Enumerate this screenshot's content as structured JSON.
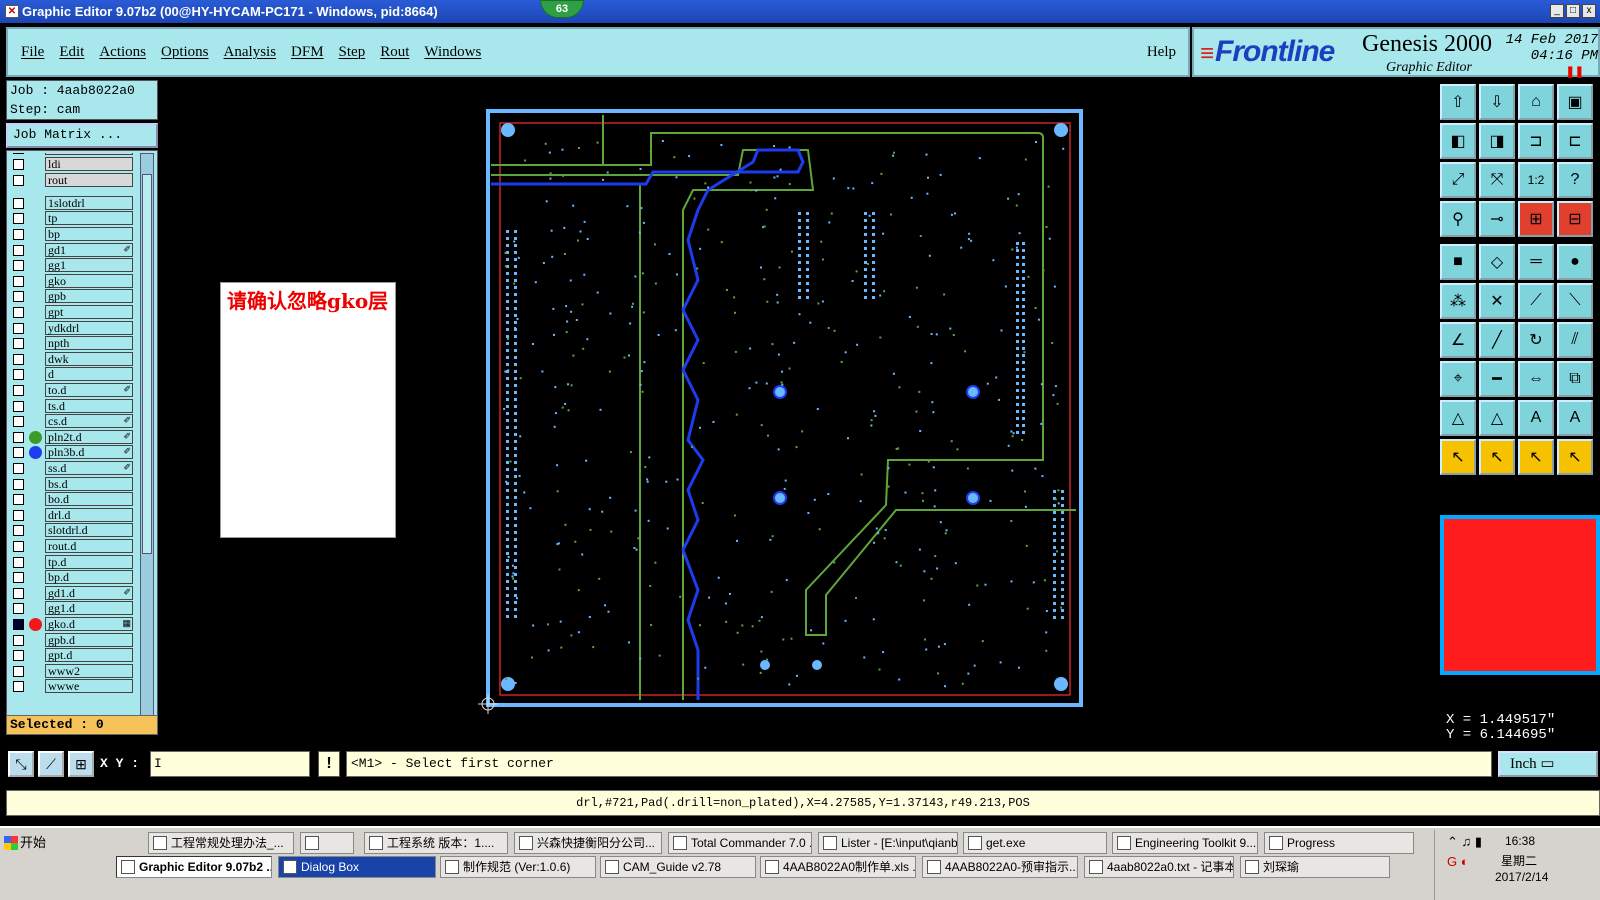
{
  "window": {
    "title": "Graphic Editor 9.07b2 (00@HY-HYCAM-PC171 - Windows, pid:8664)",
    "badge": "63",
    "controls": [
      "_",
      "□",
      "x"
    ]
  },
  "menu": {
    "items": [
      "File",
      "Edit",
      "Actions",
      "Options",
      "Analysis",
      "DFM",
      "Step",
      "Rout",
      "Windows"
    ],
    "help": "Help"
  },
  "brand": {
    "logo": "Frontline",
    "product": "Genesis 2000",
    "subtitle": "Graphic Editor",
    "date": "14 Feb 2017",
    "time": "04:16 PM"
  },
  "job": {
    "job_line": "Job : 4aab8022a0",
    "step_line": "Step: cam",
    "matrix_button": "Job Matrix ..."
  },
  "layers": [
    {
      "name": "drl",
      "gray": true
    },
    {
      "name": "ldi",
      "gray": true
    },
    {
      "name": "rout",
      "gray": true
    },
    {
      "name": "1slotdrl"
    },
    {
      "name": "tp"
    },
    {
      "name": "bp"
    },
    {
      "name": "gd1",
      "mark": "✐"
    },
    {
      "name": "gg1"
    },
    {
      "name": "gko"
    },
    {
      "name": "gpb"
    },
    {
      "name": "gpt"
    },
    {
      "name": "ydkdrl"
    },
    {
      "name": "npth"
    },
    {
      "name": "dwk"
    },
    {
      "name": "d"
    },
    {
      "name": "to.d",
      "mark": "✐"
    },
    {
      "name": "ts.d"
    },
    {
      "name": "cs.d",
      "mark": "✐"
    },
    {
      "name": "pln2t.d",
      "mark": "✐",
      "dot": "#3a9a2a"
    },
    {
      "name": "pln3b.d",
      "mark": "✐",
      "dot": "#1d3cf0"
    },
    {
      "name": "ss.d",
      "mark": "✐"
    },
    {
      "name": "bs.d"
    },
    {
      "name": "bo.d"
    },
    {
      "name": "drl.d"
    },
    {
      "name": "slotdrl.d"
    },
    {
      "name": "rout.d"
    },
    {
      "name": "tp.d"
    },
    {
      "name": "bp.d"
    },
    {
      "name": "gd1.d",
      "mark": "✐"
    },
    {
      "name": "gg1.d"
    },
    {
      "name": "gko.d",
      "mark": "▦",
      "dot": "#f01818",
      "on": true
    },
    {
      "name": "gpb.d"
    },
    {
      "name": "gpt.d"
    },
    {
      "name": "www2"
    },
    {
      "name": "wwwe"
    }
  ],
  "selected": "Selected : 0",
  "dialog_text": "请确认忽略gko层",
  "coords": {
    "x": "X = 1.449517\"",
    "y": "Y = 6.144695\""
  },
  "cmd": {
    "xy_label": "X Y :",
    "xy_value": "I",
    "warn": "!",
    "prompt": "<M1> - Select first corner",
    "units": "Inch",
    "status": "drl,#721,Pad(.drill=non_plated),X=4.27585,Y=1.37143,r49.213,POS"
  },
  "toolbar_icons": [
    "layer-up-icon",
    "layer-down-icon",
    "home-icon",
    "panel-icon",
    "move-left-icon",
    "move-right-icon",
    "snap-icon",
    "mirror-icon",
    "fit-icon",
    "zoom-fit-icon",
    "scale-icon",
    "help-icon",
    "measure-icon",
    "pad-icon",
    "net-icon",
    "net2-icon",
    "frame-icon",
    "edit-shape-icon",
    "ruler-icon",
    "fill-icon",
    "node-icon",
    "cross-icon",
    "line-icon",
    "line2-icon",
    "arc-icon",
    "slash-icon",
    "rotate-icon",
    "split-icon",
    "drag-icon",
    "minus-icon",
    "align-icon",
    "copy-icon",
    "triangle-icon",
    "triangle2-icon",
    "text-icon",
    "text2-icon",
    "pointer-icon",
    "pointer2-icon",
    "pointer3-icon",
    "pointer4-icon"
  ],
  "taskbar": {
    "start": "开始",
    "row1": [
      {
        "label": "工程常规处理办法_..."
      },
      {
        "label": ""
      },
      {
        "label": "工程系统  版本：1...."
      },
      {
        "label": "兴森快捷衡阳分公司..."
      },
      {
        "label": "Total Commander 7.0 ..."
      },
      {
        "label": "Lister - [E:\\input\\qianb..."
      },
      {
        "label": "get.exe"
      },
      {
        "label": "Engineering Toolkit 9...."
      },
      {
        "label": "Progress"
      }
    ],
    "row2": [
      {
        "label": "Graphic Editor 9.07b2 ...",
        "active": true
      },
      {
        "label": "Dialog Box",
        "dlg": true
      },
      {
        "label": "制作规范 (Ver:1.0.6)"
      },
      {
        "label": "CAM_Guide v2.78"
      },
      {
        "label": "4AAB8022A0制作单.xls ..."
      },
      {
        "label": "4AAB8022A0-预审指示...."
      },
      {
        "label": "4aab8022a0.txt - 记事本"
      },
      {
        "label": "刘琛瑜"
      }
    ],
    "clock_time": "16:38",
    "clock_day": "星期二",
    "clock_date": "2017/2/14"
  },
  "colors": {
    "panel": "#a8e8ec",
    "board_outline": "#6ab8ff",
    "trace_green": "#5fa63a",
    "trace_blue": "#1d3cf0",
    "rout_red": "#cc2222",
    "preview": "#ff1c1c"
  }
}
